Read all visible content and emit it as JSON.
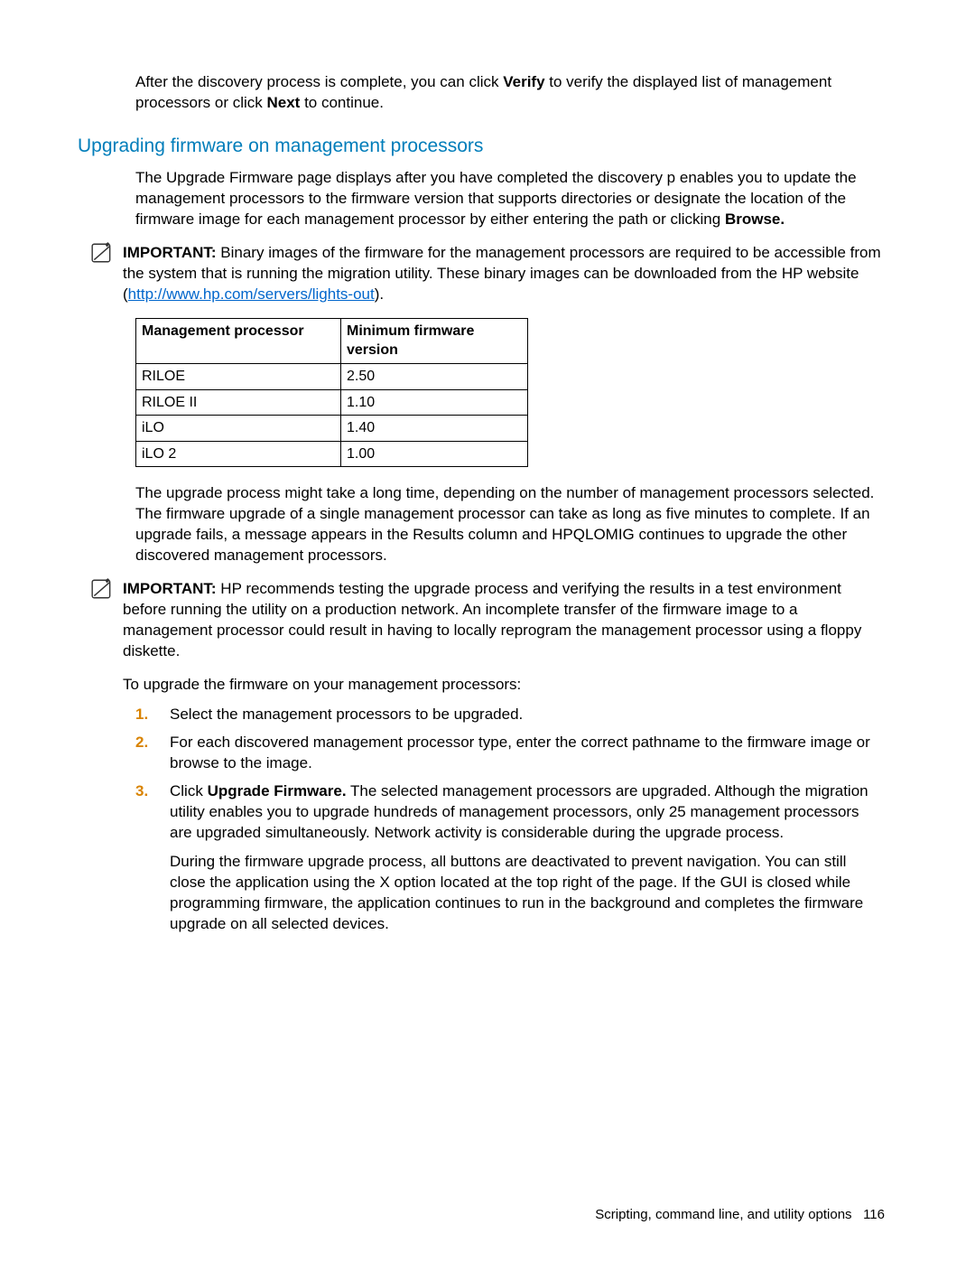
{
  "intro": {
    "p1_a": "After the discovery process is complete, you can click ",
    "p1_verify": "Verify",
    "p1_b": " to verify the displayed list of management processors or click ",
    "p1_next": "Next",
    "p1_c": " to continue."
  },
  "heading": "Upgrading firmware on management processors",
  "upgrade_intro_a": "The Upgrade Firmware page displays after you have completed the discovery p enables you to update the management processors to the firmware version that supports directories or designate the location of the firmware image for each management processor by either entering the path or clicking ",
  "upgrade_intro_browse": "Browse.",
  "important1": {
    "label": "IMPORTANT:",
    "text_a": "  Binary images of the firmware for the management processors are required to be accessible from the system that is running the migration utility. These binary images can be downloaded from the HP website (",
    "link_text": "http://www.hp.com/servers/lights-out",
    "text_b": ")."
  },
  "table": {
    "h1": "Management processor",
    "h2": "Minimum firmware version",
    "rows": [
      {
        "c1": "RILOE",
        "c2": "2.50"
      },
      {
        "c1": "RILOE II",
        "c2": "1.10"
      },
      {
        "c1": "iLO",
        "c2": "1.40"
      },
      {
        "c1": "iLO 2",
        "c2": "1.00"
      }
    ]
  },
  "after_table": "The upgrade process might take a long time, depending on the number of management processors selected. The firmware upgrade of a single management processor can take as long as five minutes to complete. If an upgrade fails, a message appears in the Results column and HPQLOMIG continues to upgrade the other discovered management processors.",
  "important2": {
    "label": "IMPORTANT:",
    "text": "  HP recommends testing the upgrade process and verifying the results in a test environment before running the utility on a production network. An incomplete transfer of the firmware image to a management processor could result in having to locally reprogram the management processor using a floppy diskette."
  },
  "steps_intro": "To upgrade the firmware on your management processors:",
  "steps": {
    "s1": "Select the management processors to be upgraded.",
    "s2": "For each discovered management processor type, enter the correct pathname to the firmware image or browse to the image.",
    "s3_a": "Click ",
    "s3_bold": "Upgrade Firmware.",
    "s3_b": " The selected management processors are upgraded. Although the migration utility enables you to upgrade hundreds of management processors, only 25 management processors are upgraded simultaneously. Network activity is considerable during the upgrade process.",
    "s3_sub": "During the firmware upgrade process, all buttons are deactivated to prevent navigation. You can still close the application using the X option located at the top right of the page. If the GUI is closed while programming firmware, the application continues to run in the background and completes the firmware upgrade on all selected devices."
  },
  "footer_text": "Scripting, command line, and utility options",
  "footer_page": "116"
}
